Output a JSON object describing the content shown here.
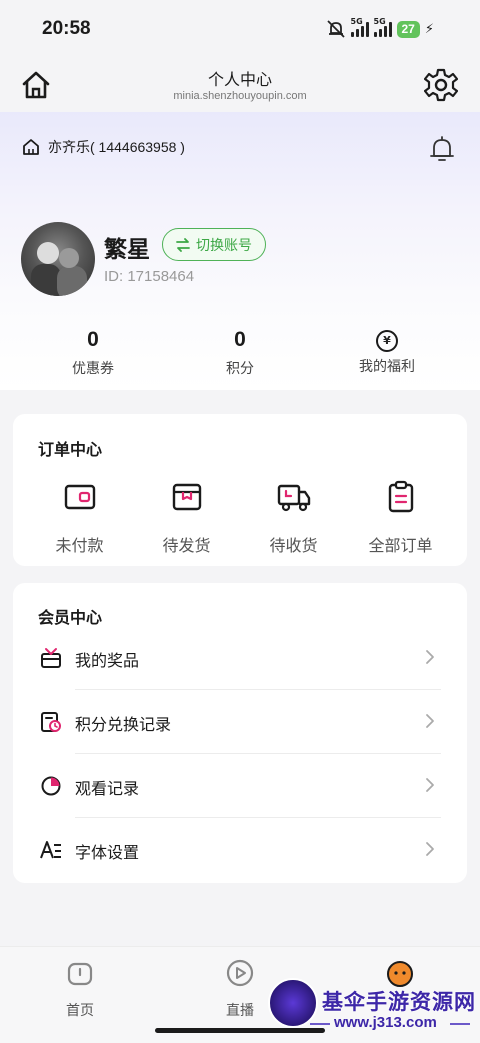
{
  "status_bar": {
    "time": "20:58",
    "signal1_label": "5G",
    "signal2_label": "5G",
    "battery": "27"
  },
  "header": {
    "title": "个人中心",
    "subtitle": "minia.shenzhouyoupin.com"
  },
  "shop": {
    "name": "亦齐乐( 1444663958 )"
  },
  "profile": {
    "nickname": "繁星",
    "switch_label": "切换账号",
    "user_id": "ID: 17158464"
  },
  "stats": [
    {
      "value": "0",
      "label": "优惠券"
    },
    {
      "value": "0",
      "label": "积分"
    },
    {
      "icon_text": "¥",
      "label": "我的福利"
    }
  ],
  "order_center": {
    "title": "订单中心",
    "items": [
      {
        "label": "未付款",
        "icon": "wallet-icon"
      },
      {
        "label": "待发货",
        "icon": "package-icon"
      },
      {
        "label": "待收货",
        "icon": "truck-icon"
      },
      {
        "label": "全部订单",
        "icon": "clipboard-icon"
      }
    ]
  },
  "member_center": {
    "title": "会员中心",
    "items": [
      {
        "label": "我的奖品",
        "icon": "gift-icon"
      },
      {
        "label": "积分兑换记录",
        "icon": "exchange-record-icon"
      },
      {
        "label": "观看记录",
        "icon": "pie-chart-icon"
      },
      {
        "label": "字体设置",
        "icon": "font-icon"
      }
    ]
  },
  "bottom_nav": [
    {
      "label": "首页",
      "icon": "home-tab-icon"
    },
    {
      "label": "直播",
      "icon": "play-icon"
    },
    {
      "label": "",
      "icon": "profile-face-icon"
    }
  ],
  "watermark": {
    "title": "基伞手游资源网",
    "url": "www.j313.com"
  },
  "colors": {
    "accent_pink": "#e0266f",
    "switch_green": "#4fb257",
    "text_dark": "#1b1b1b",
    "background": "#f4f4f6"
  }
}
